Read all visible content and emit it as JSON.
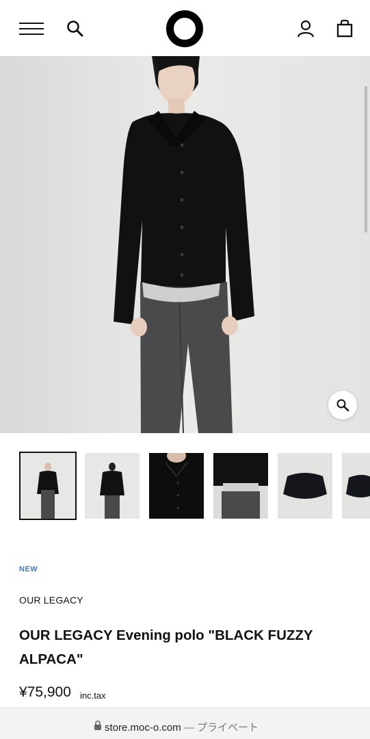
{
  "header": {
    "menu_icon": "hamburger-icon",
    "search_icon": "search-icon",
    "logo_icon": "ring-logo",
    "account_icon": "user-icon",
    "bag_icon": "shopping-bag-icon"
  },
  "gallery": {
    "zoom_icon": "magnifier-icon",
    "thumbnail_count": 6,
    "active_index": 0
  },
  "product": {
    "badge": "NEW",
    "brand": "OUR LEGACY",
    "title": "OUR LEGACY Evening polo \"BLACK FUZZY ALPACA\"",
    "price": "¥75,900",
    "tax": "inc.tax"
  },
  "browser": {
    "url": "store.moc-o.com",
    "separator": "—",
    "mode": "プライベート",
    "lock_icon": "lock-icon"
  },
  "colors": {
    "badge": "#3f79c2",
    "text": "#111111"
  }
}
